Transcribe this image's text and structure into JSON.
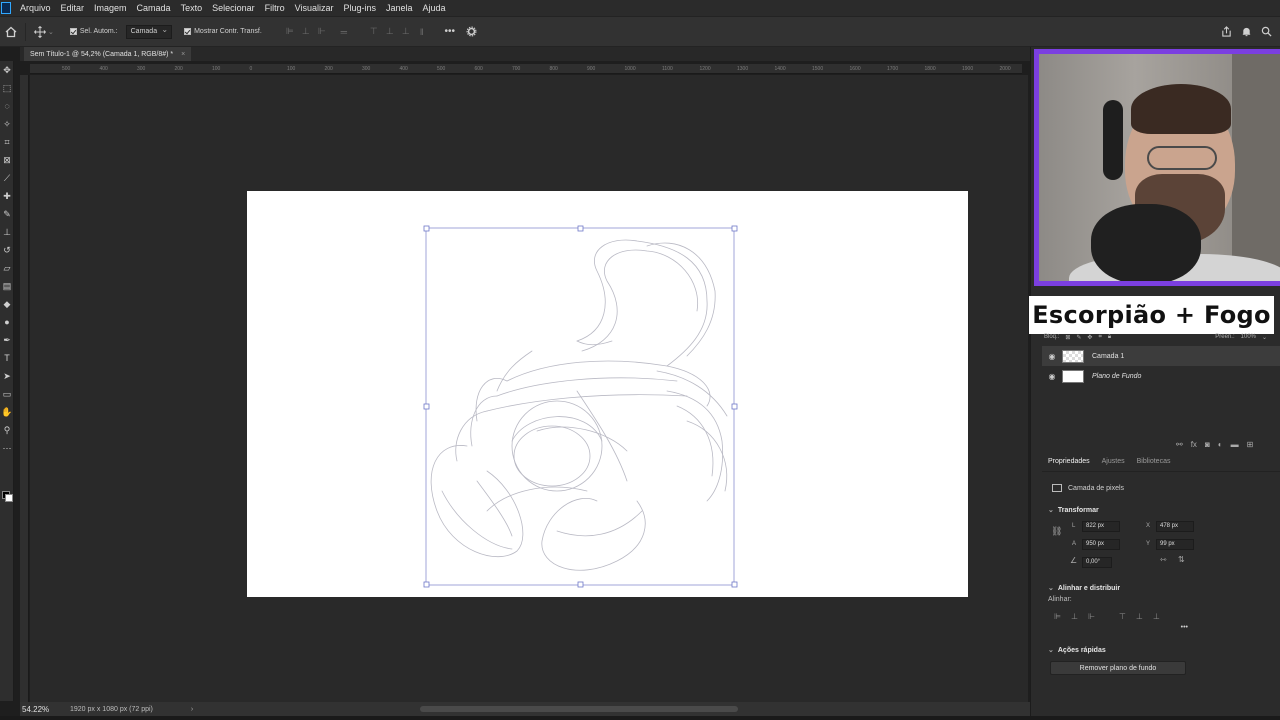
{
  "menu": [
    "Arquivo",
    "Editar",
    "Imagem",
    "Camada",
    "Texto",
    "Selecionar",
    "Filtro",
    "Visualizar",
    "Plug-ins",
    "Janela",
    "Ajuda"
  ],
  "options": {
    "auto_select_label": "Sel. Autom.:",
    "auto_select_target": "Camada",
    "show_transform_label": "Mostrar Contr. Transf."
  },
  "document": {
    "tab_title": "Sem Título-1 @ 54,2% (Camada 1, RGB/8#) *",
    "tab_close": "×"
  },
  "ruler_ticks": [
    "500",
    "400",
    "300",
    "200",
    "100",
    "0",
    "100",
    "200",
    "300",
    "400",
    "500",
    "600",
    "700",
    "800",
    "900",
    "1000",
    "1100",
    "1200",
    "1300",
    "1400",
    "1500",
    "1600",
    "1700",
    "1800",
    "1900",
    "2000"
  ],
  "status": {
    "zoom": "54.22%",
    "info": "1920 px x 1080 px (72 ppi)",
    "arrow": "›"
  },
  "overlay_title": "Escorpião + Fogo",
  "layers": {
    "lock_label": "Bloq.:",
    "fill_label": "Preen.:",
    "fill_value": "100%",
    "items": [
      {
        "name": "Camada 1",
        "thumb": "checker",
        "selected": true
      },
      {
        "name": "Plano de Fundo",
        "thumb": "white",
        "selected": false
      }
    ]
  },
  "properties": {
    "tabs": [
      "Propriedades",
      "Ajustes",
      "Bibliotecas"
    ],
    "kind": "Camada de pixels",
    "transform_header": "Transformar",
    "width": "822 px",
    "height": "950 px",
    "x": "478 px",
    "y": "99 px",
    "angle": "0,00°",
    "labels": {
      "w": "L",
      "h": "A",
      "x": "X",
      "y": "Y"
    },
    "align_header": "Alinhar e distribuir",
    "align_label": "Alinhar:",
    "more": "•••",
    "quick_header": "Ações rápidas",
    "quick_button": "Remover plano de fundo"
  },
  "icons": {
    "home": "home-icon",
    "move": "move-icon",
    "settings": "gear-icon",
    "share": "share-icon",
    "bell": "bell-icon",
    "search": "search-icon"
  },
  "colors": {
    "accent_frame": "#7b3fe0",
    "canvas": "#ffffff",
    "workspace": "#292929"
  }
}
